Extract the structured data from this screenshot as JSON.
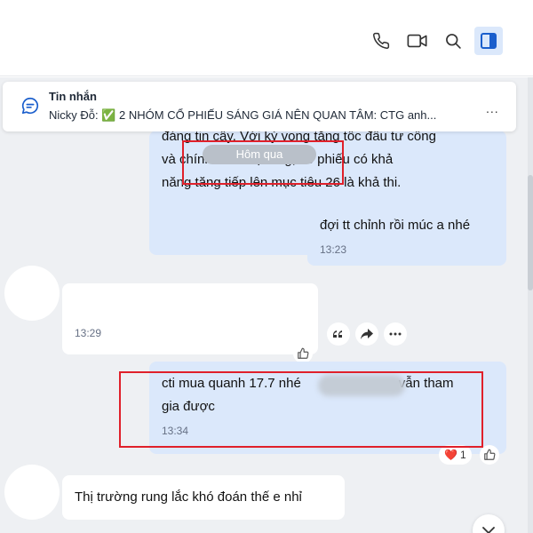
{
  "header": {
    "icons": [
      "phone-icon",
      "video-icon",
      "search-icon",
      "side-panel-icon"
    ],
    "accent": "#1a5ecc"
  },
  "pinned": {
    "title": "Tin nhắn",
    "text": "Nicky Đỗ: ✅ 2 NHÓM CỔ PHIẾU SÁNG GIÁ NÊN QUAN TÂM: CTG anh...",
    "more": "..."
  },
  "date_chip": "Hôm qua",
  "messages": [
    {
      "direction": "out",
      "lines": [
        "đáng tin cậy. Với kỳ vọng tăng tốc đầu tư công",
        "và chính sách hạ tầng, cổ phiếu có khả",
        "năng tăng tiếp lên mục tiêu 26 là khả thi."
      ]
    },
    {
      "direction": "out",
      "text": "đợi tt chỉnh rồi múc a nhé",
      "time": "13:23"
    },
    {
      "direction": "in",
      "text": "",
      "time": "13:29"
    },
    {
      "direction": "out",
      "lines": [
        "cti mua quanh 17.7 nhé",
        "vẫn tham",
        "gia được"
      ],
      "time": "13:34",
      "reaction": {
        "emoji": "❤️",
        "count": "1"
      }
    },
    {
      "direction": "in",
      "text": "Thị trường rung lắc khó đoán thế e nhỉ"
    }
  ],
  "colors": {
    "chat_bg": "#eef0f3",
    "bubble_out": "#dbe8fb",
    "bubble_in": "#ffffff",
    "highlight": "#e0202a"
  }
}
